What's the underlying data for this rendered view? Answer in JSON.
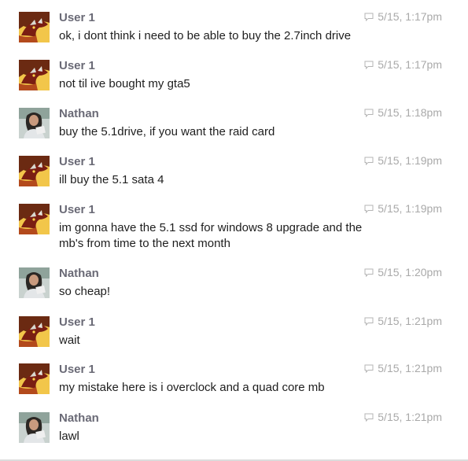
{
  "messages": [
    {
      "sender": "User 1",
      "avatar": "dragon-avatar",
      "time": "5/15, 1:17pm",
      "text": "ok, i dont think i need to be able to buy the 2.7inch drive"
    },
    {
      "sender": "User 1",
      "avatar": "dragon-avatar",
      "time": "5/15, 1:17pm",
      "text": "not til ive bought my gta5"
    },
    {
      "sender": "Nathan",
      "avatar": "person-avatar",
      "time": "5/15, 1:18pm",
      "text": "buy the 5.1drive, if you want the raid card"
    },
    {
      "sender": "User 1",
      "avatar": "dragon-avatar",
      "time": "5/15, 1:19pm",
      "text": "ill buy the 5.1 sata 4"
    },
    {
      "sender": "User 1",
      "avatar": "dragon-avatar",
      "time": "5/15, 1:19pm",
      "text": "im gonna have the 5.1 ssd for windows 8 upgrade and the mb's from time to the next month"
    },
    {
      "sender": "Nathan",
      "avatar": "person-avatar",
      "time": "5/15, 1:20pm",
      "text": "so cheap!"
    },
    {
      "sender": "User 1",
      "avatar": "dragon-avatar",
      "time": "5/15, 1:21pm",
      "text": "wait"
    },
    {
      "sender": "User 1",
      "avatar": "dragon-avatar",
      "time": "5/15, 1:21pm",
      "text": "my mistake here is i overclock and a quad core mb"
    },
    {
      "sender": "Nathan",
      "avatar": "person-avatar",
      "time": "5/15, 1:21pm",
      "text": "lawl"
    }
  ],
  "icons": {
    "reply": "reply-icon"
  },
  "colors": {
    "sender": "#6a6a76",
    "timestamp": "#a9a9a9",
    "message_text": "#1e1e1e"
  }
}
